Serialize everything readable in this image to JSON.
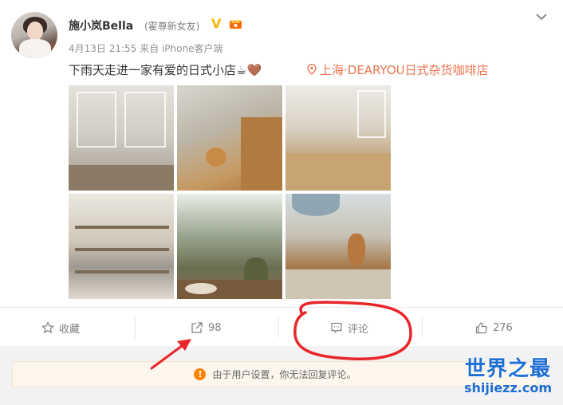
{
  "post": {
    "username": "施小岚Bella",
    "remark": "(霍尊新女友)",
    "time": "4月13日 21:55",
    "source": "来自 iPhone客户端",
    "text": "下雨天走进一家有爱的日式小店☕🤎",
    "location": "上海·DEARYOU日式杂货咖啡店",
    "photos": [
      "photo-1",
      "photo-2",
      "photo-3",
      "photo-4",
      "photo-5",
      "photo-6"
    ]
  },
  "actions": {
    "favorite_label": "收藏",
    "share_count": "98",
    "comment_label": "评论",
    "like_count": "276"
  },
  "notice": {
    "text": "由于用户设置，你无法回复评论。"
  },
  "watermark": {
    "cn": "世界之最",
    "en": "shijiezz.com"
  },
  "colors": {
    "location": "#eb7350",
    "vip": "#f7b500",
    "annotation_red": "#e8262a",
    "watermark_blue": "#1e6fd2"
  },
  "icons": [
    "more-icon",
    "vip-icon",
    "crown-icon",
    "location-pin-icon",
    "star-icon",
    "share-icon",
    "comment-icon",
    "thumbs-up-icon",
    "warning-icon"
  ]
}
